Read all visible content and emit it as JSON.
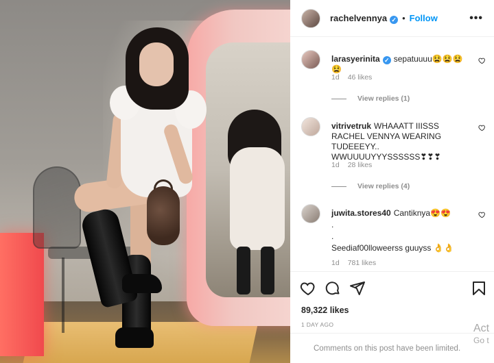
{
  "post": {
    "username": "rachelvennya",
    "verified": true,
    "separator": "•",
    "follow_label": "Follow",
    "more_label": "•••"
  },
  "comments": [
    {
      "username": "larasyerinita",
      "verified": true,
      "text": "sepatuuuu😫😫😫😫",
      "age": "1d",
      "likes": "46 likes",
      "view_replies": "View replies (1)"
    },
    {
      "username": "vitrivetruk",
      "verified": false,
      "text": "WHAAATT IIISSS RACHEL VENNYA WEARING TUDEEEYY.. WWUUUUYYYSSSSSS❣❣❣",
      "age": "1d",
      "likes": "28 likes",
      "view_replies": "View replies (4)"
    },
    {
      "username": "juwita.stores40",
      "verified": false,
      "text": "Cantiknya😍😍",
      "line2": ".",
      "line3": ".",
      "line4": "Seediaf00lloweerss guuyss 👌👌",
      "age": "1d",
      "likes": "781 likes"
    }
  ],
  "footer": {
    "likes": "89,322 likes",
    "date": "1 DAY AGO",
    "comments_limited": "Comments on this post have been limited."
  },
  "watermark": {
    "line1": "Act",
    "line2": "Go t"
  },
  "colors": {
    "accent": "#0095f6",
    "verified": "#3897f0",
    "muted": "#8e8e8e"
  }
}
